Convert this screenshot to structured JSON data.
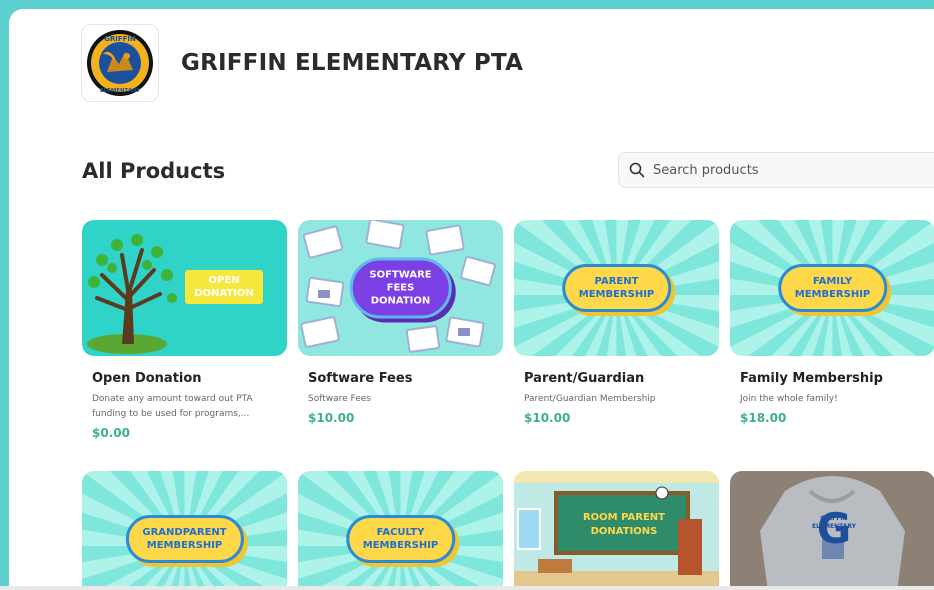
{
  "store": {
    "name": "GRIFFIN ELEMENTARY PTA",
    "logo_ring_top": "GRIFFIN",
    "logo_ring_bottom": "ELEMENTARY"
  },
  "section": {
    "title": "All Products"
  },
  "search": {
    "placeholder": "Search products"
  },
  "colors": {
    "accent": "#5ecfcf",
    "price": "#3bb08f",
    "bubble_yellow": "#ffd84a",
    "bubble_blue": "#1f6fd1"
  },
  "products": [
    {
      "name": "Open Donation",
      "description": "Donate any amount toward out PTA funding to be used for programs,...",
      "price": "$0.00",
      "image_text": "OPEN\nDONATION"
    },
    {
      "name": "Software Fees",
      "description": "Software Fees",
      "price": "$10.00",
      "image_text": "SOFTWARE\nFEES DONATION"
    },
    {
      "name": "Parent/Guardian",
      "description": "Parent/Guardian Membership",
      "price": "$10.00",
      "image_text": "PARENT\nMEMBERSHIP"
    },
    {
      "name": "Family Membership",
      "description": "Join the whole family!",
      "price": "$18.00",
      "image_text": "FAMILY\nMEMBERSHIP"
    },
    {
      "image_text": "GRANDPARENT\nMEMBERSHIP"
    },
    {
      "image_text": "FACULTY\nMEMBERSHIP"
    },
    {
      "image_text": "ROOM PARENT\nDONATIONS"
    },
    {
      "image_text": "GRIFFIN\nELEMENTARY",
      "image_letter": "G"
    }
  ]
}
